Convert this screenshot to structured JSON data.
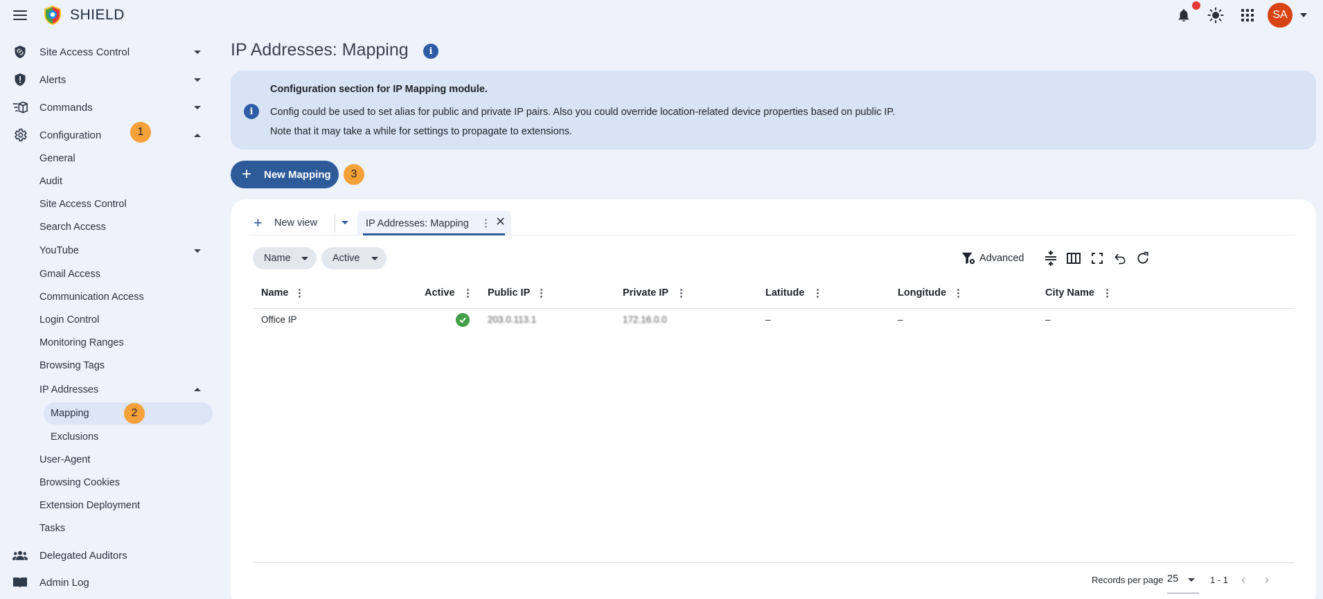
{
  "app": {
    "brand": "SHIELD"
  },
  "header": {
    "avatar_initials": "SA"
  },
  "sidebar": {
    "site_access_control": "Site Access Control",
    "alerts": "Alerts",
    "commands": "Commands",
    "configuration": "Configuration",
    "configuration_badge": "1",
    "config_items": {
      "general": "General",
      "audit": "Audit",
      "site_access_control": "Site Access Control",
      "search_access": "Search Access",
      "youtube": "YouTube",
      "gmail_access": "Gmail Access",
      "communication_access": "Communication Access",
      "login_control": "Login Control",
      "monitoring_ranges": "Monitoring Ranges",
      "browsing_tags": "Browsing Tags",
      "ip_addresses": "IP Addresses",
      "mapping": "Mapping",
      "mapping_badge": "2",
      "exclusions": "Exclusions",
      "user_agent": "User-Agent",
      "browsing_cookies": "Browsing Cookies",
      "extension_deployment": "Extension Deployment",
      "tasks": "Tasks"
    },
    "delegated_auditors": "Delegated Auditors",
    "admin_log": "Admin Log"
  },
  "main": {
    "title": "IP Addresses: Mapping",
    "info": {
      "heading": "Configuration section for IP Mapping module.",
      "line1": "Config could be used to set alias for public and private IP pairs. Also you could override location-related device properties based on public IP.",
      "line2": "Note that it may take a while for settings to propagate to extensions."
    },
    "new_button": "New Mapping",
    "new_button_badge": "3"
  },
  "table": {
    "new_view": "New view",
    "active_tab": "IP Addresses: Mapping",
    "filters": [
      "Name",
      "Active"
    ],
    "advanced": "Advanced",
    "columns": [
      "Name",
      "Active",
      "Public IP",
      "Private IP",
      "Latitude",
      "Longitude",
      "City Name"
    ],
    "rows": [
      {
        "name": "Office IP",
        "active": true,
        "public_ip": "203.0.113.1",
        "private_ip": "172.16.0.0",
        "latitude": "–",
        "longitude": "–",
        "city": "–"
      }
    ],
    "records_per_page_label": "Records per page",
    "records_per_page": "25",
    "range": "1 - 1"
  },
  "colors": {
    "accent": "#2d5a98",
    "badge": "#f5a13a",
    "avatar": "#d84315",
    "active": "#43a047"
  },
  "icons": [
    "menu-icon",
    "shield-logo-icon",
    "bell-icon",
    "theme-sun-icon",
    "apps-grid-icon",
    "info-icon",
    "check-circle-icon",
    "advanced-filter-icon",
    "density-icon",
    "columns-icon",
    "fullscreen-icon",
    "undo-icon",
    "refresh-icon"
  ]
}
